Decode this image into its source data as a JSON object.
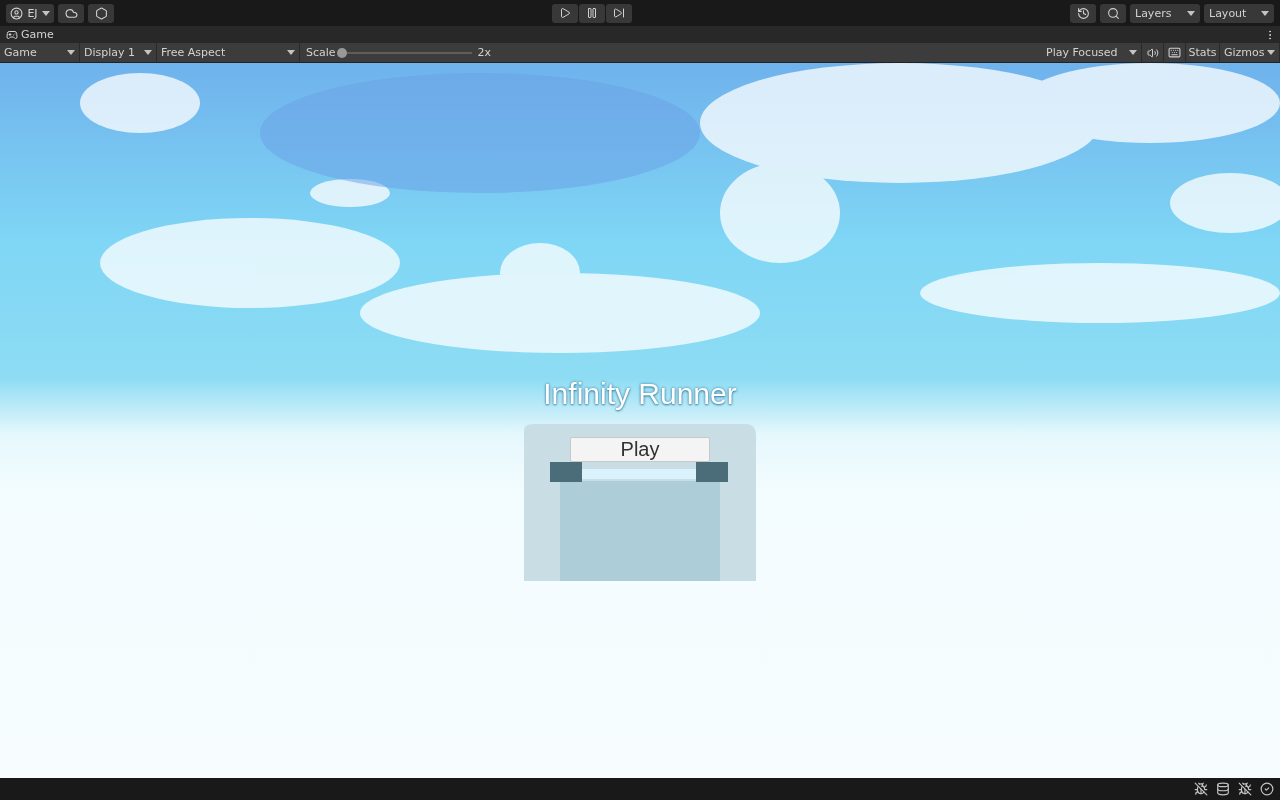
{
  "top_bar": {
    "account": "EJ",
    "layers": "Layers",
    "layout": "Layout"
  },
  "tab": {
    "label": "Game"
  },
  "toolbar": {
    "dropdowns": [
      "Game",
      "Display 1",
      "Free Aspect"
    ],
    "scale": {
      "label": "Scale",
      "level": 0,
      "reading": "2x"
    },
    "play_mode": "Play Focused",
    "stats": "Stats",
    "gizmos": "Gizmos"
  },
  "game_view": {
    "title": "Infinity Runner",
    "button": "Play"
  }
}
